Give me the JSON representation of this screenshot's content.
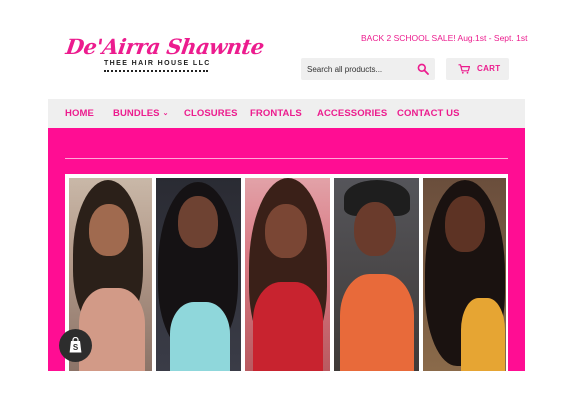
{
  "brand": {
    "name": "De'Airra Shawnte",
    "subtitle": "THEE HAIR HOUSE LLC",
    "color": "#ec1c8e"
  },
  "header": {
    "promo": "BACK 2 SCHOOL SALE! Aug.1st - Sept. 1st",
    "search": {
      "placeholder": "Search all products...",
      "icon": "search-icon"
    },
    "cart": {
      "label": "CART",
      "icon": "cart-icon"
    }
  },
  "nav": {
    "items": [
      {
        "label": "HOME"
      },
      {
        "label": "BUNDLES",
        "dropdown": true
      },
      {
        "label": "CLOSURES"
      },
      {
        "label": "FRONTALS"
      },
      {
        "label": "ACCESSORIES"
      },
      {
        "label": "CONTACT US"
      }
    ]
  },
  "hero": {
    "background": "#ff0d93",
    "photos": [
      {
        "name": "model-photo-1"
      },
      {
        "name": "model-photo-2"
      },
      {
        "name": "model-photo-3"
      },
      {
        "name": "model-photo-4"
      },
      {
        "name": "model-photo-5"
      }
    ]
  },
  "badge": {
    "icon": "shopify-bag-icon"
  }
}
